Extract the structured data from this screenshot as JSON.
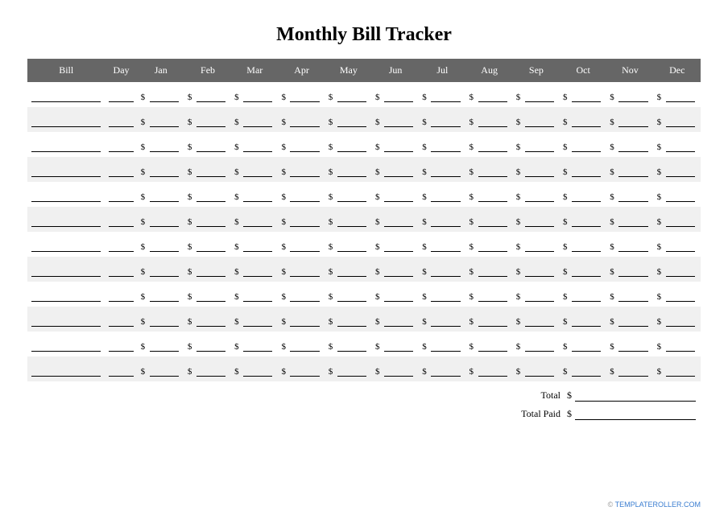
{
  "title": "Monthly Bill Tracker",
  "currency": "$",
  "headers": {
    "bill": "Bill",
    "day": "Day",
    "months": [
      "Jan",
      "Feb",
      "Mar",
      "Apr",
      "May",
      "Jun",
      "Jul",
      "Aug",
      "Sep",
      "Oct",
      "Nov",
      "Dec"
    ]
  },
  "row_count": 12,
  "totals": {
    "total_label": "Total",
    "total_paid_label": "Total Paid",
    "total_value": "",
    "total_paid_value": ""
  },
  "footer": {
    "prefix": "© ",
    "url": "TEMPLATEROLLER.COM"
  }
}
